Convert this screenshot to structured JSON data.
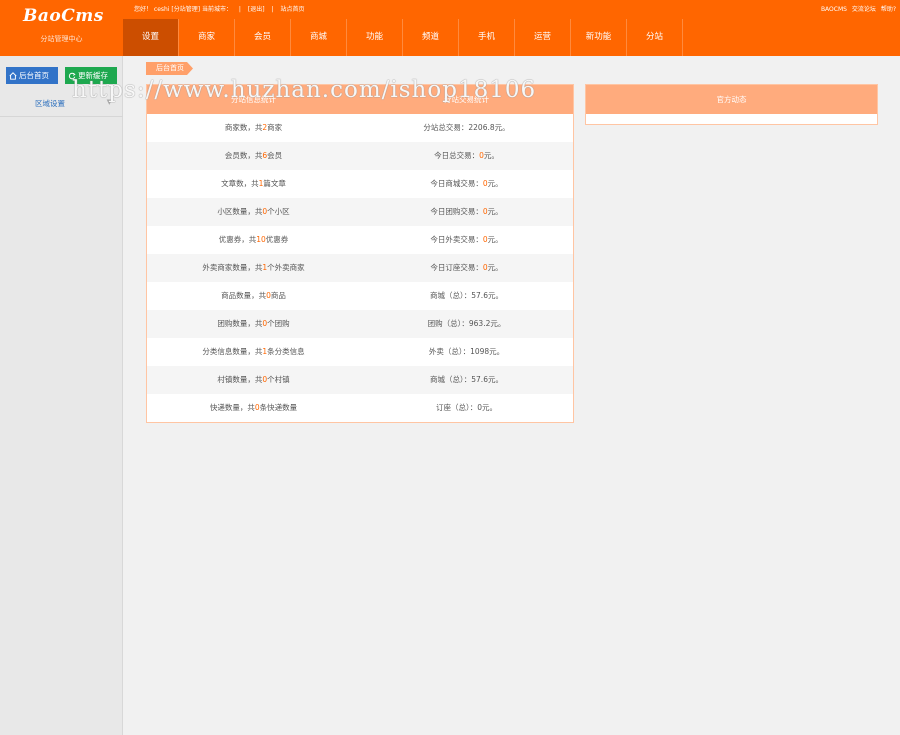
{
  "header": {
    "logo": "BaoCms",
    "subtitle": "分站管理中心",
    "welcome": "您好！ ceshi [分站管理] 当前城市：",
    "logout": "[退出]",
    "site_home": "站点首页",
    "right_links": [
      "BAOCMS",
      "交流论坛",
      "帮助?"
    ]
  },
  "nav": {
    "items": [
      "设置",
      "商家",
      "会员",
      "商城",
      "功能",
      "频道",
      "手机",
      "运营",
      "新功能",
      "分站"
    ],
    "active_index": 0
  },
  "sidebar": {
    "home_button": "后台首页",
    "cache_button": "更新缓存",
    "link": "区域设置"
  },
  "breadcrumb": "后台首页",
  "stats": {
    "col_left": "分站信息统计",
    "col_right": "分站交易统计",
    "rows": [
      {
        "l_pre": "商家数，共",
        "l_num": "2",
        "l_suf": "商家",
        "r_pre": "分站总交易：",
        "r_num": "",
        "r_suf": "2206.8元。"
      },
      {
        "l_pre": "会员数，共",
        "l_num": "6",
        "l_suf": "会员",
        "r_pre": "今日总交易：",
        "r_num": "0",
        "r_suf": "元。"
      },
      {
        "l_pre": "文章数，共",
        "l_num": "1",
        "l_suf": "篇文章",
        "r_pre": "今日商城交易：",
        "r_num": "0",
        "r_suf": "元。"
      },
      {
        "l_pre": "小区数量，共",
        "l_num": "0",
        "l_suf": "个小区",
        "r_pre": "今日团购交易：",
        "r_num": "0",
        "r_suf": "元。"
      },
      {
        "l_pre": "优惠券，共",
        "l_num": "10",
        "l_suf": "优惠券",
        "r_pre": "今日外卖交易：",
        "r_num": "0",
        "r_suf": "元。"
      },
      {
        "l_pre": "外卖商家数量，共",
        "l_num": "1",
        "l_suf": "个外卖商家",
        "r_pre": "今日订座交易：",
        "r_num": "0",
        "r_suf": "元。"
      },
      {
        "l_pre": "商品数量，共",
        "l_num": "0",
        "l_suf": "商品",
        "r_pre": "商城（总）：",
        "r_num": "",
        "r_suf": "57.6元。"
      },
      {
        "l_pre": "团购数量，共",
        "l_num": "0",
        "l_suf": "个团购",
        "r_pre": "团购（总）：",
        "r_num": "",
        "r_suf": "963.2元。"
      },
      {
        "l_pre": "分类信息数量，共",
        "l_num": "1",
        "l_suf": "条分类信息",
        "r_pre": "外卖（总）：",
        "r_num": "",
        "r_suf": "1098元。"
      },
      {
        "l_pre": "村镇数量，共",
        "l_num": "0",
        "l_suf": "个村镇",
        "r_pre": "商城（总）：",
        "r_num": "",
        "r_suf": "57.6元。"
      },
      {
        "l_pre": "快递数量，共",
        "l_num": "0",
        "l_suf": "条快递数量",
        "r_pre": "订座（总）：",
        "r_num": "",
        "r_suf": "0元。"
      }
    ]
  },
  "official": {
    "title": "官方动态"
  },
  "watermark": "https://www.huzhan.com/ishop18106",
  "colors": {
    "brand": "#ff6600",
    "panel_head": "#ffab7d",
    "home_btn": "#3273c8",
    "cache_btn": "#1ea84f"
  }
}
